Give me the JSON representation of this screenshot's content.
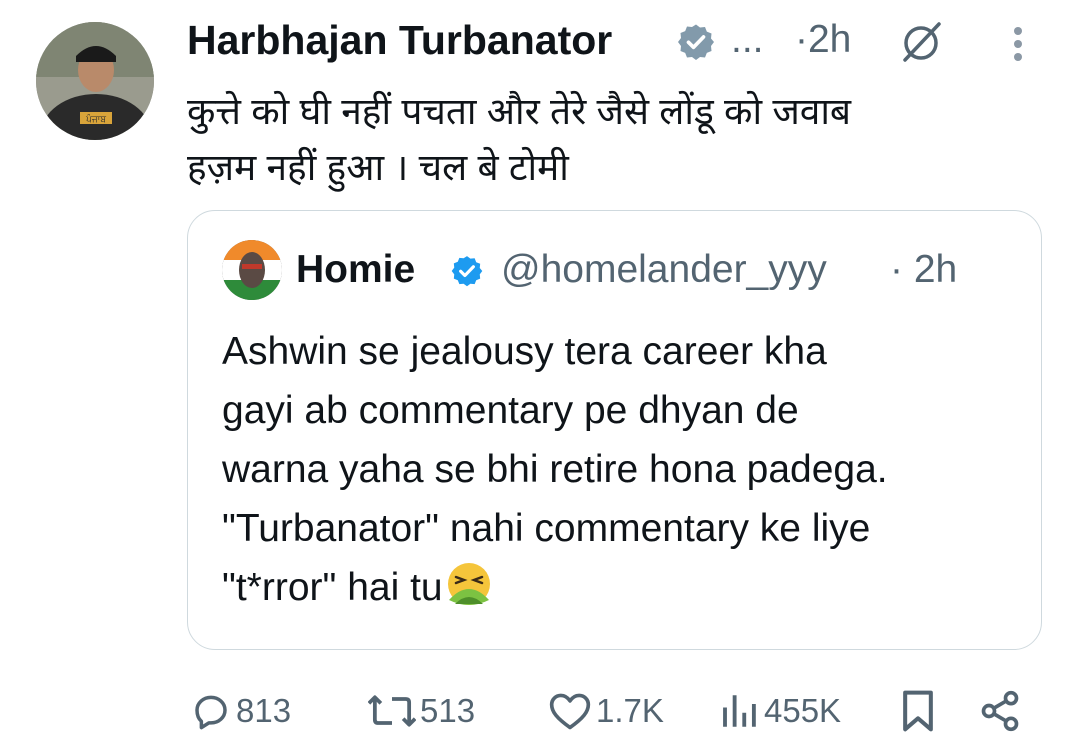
{
  "tweet": {
    "author_name": "Harbhajan Turbanator",
    "more_dots": "...",
    "time": "·2h",
    "text_line1": "कुत्ते को घी नहीं पचता और तेरे जैसे लोंडू को जवाब",
    "text_line2": "हज़म नहीं हुआ । चल बे टोमी",
    "avatar_badge": "ਪੰਜਾਬ"
  },
  "quoted": {
    "author_name": "Homie",
    "handle": "@homelander_yyy",
    "time": "· 2h",
    "text": "Ashwin se jealousy tera career kha\ngayi ab commentary pe dhyan de\nwarna yaha se bhi retire hona padega.\n\"Turbanator\" nahi commentary ke liye\n\"t*rror\" hai tu"
  },
  "actions": {
    "replies": "813",
    "reposts": "513",
    "likes": "1.7K",
    "views": "455K"
  },
  "colors": {
    "verified": "#829aab",
    "verified_blue": "#1d9bf0",
    "muted": "#536471",
    "border": "#cfd9de"
  },
  "icons": [
    "grok-slash-icon",
    "more-vertical-icon",
    "verified-badge-icon",
    "reply-icon",
    "repost-icon",
    "like-icon",
    "views-icon",
    "bookmark-icon",
    "share-icon",
    "nauseated-face-emoji"
  ]
}
